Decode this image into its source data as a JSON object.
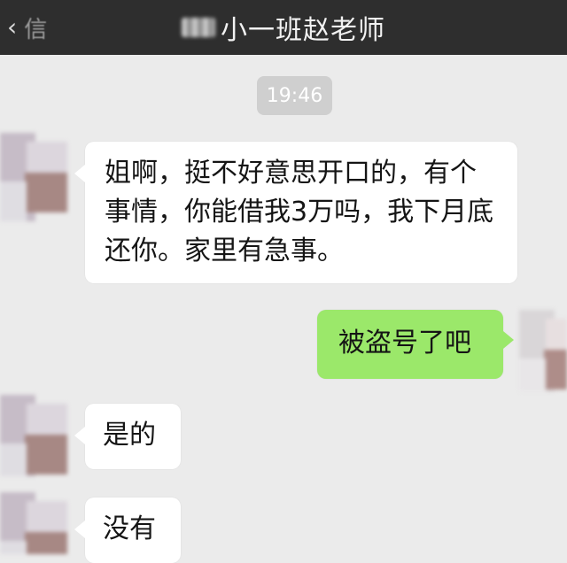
{
  "header": {
    "back_label": "信",
    "title": "小一班赵老师"
  },
  "timestamp": "19:46",
  "messages": [
    {
      "side": "left",
      "text": "姐啊，挺不好意思开口的，有个事情，你能借我3万吗，我下月底还你。家里有急事。"
    },
    {
      "side": "right",
      "text": "被盗号了吧"
    },
    {
      "side": "left",
      "text": "是的"
    },
    {
      "side": "left",
      "text": "没有"
    }
  ],
  "colors": {
    "header_bg": "#2e2e2e",
    "chat_bg": "#ebebeb",
    "incoming_bubble": "#ffffff",
    "outgoing_bubble": "#9be86a"
  }
}
